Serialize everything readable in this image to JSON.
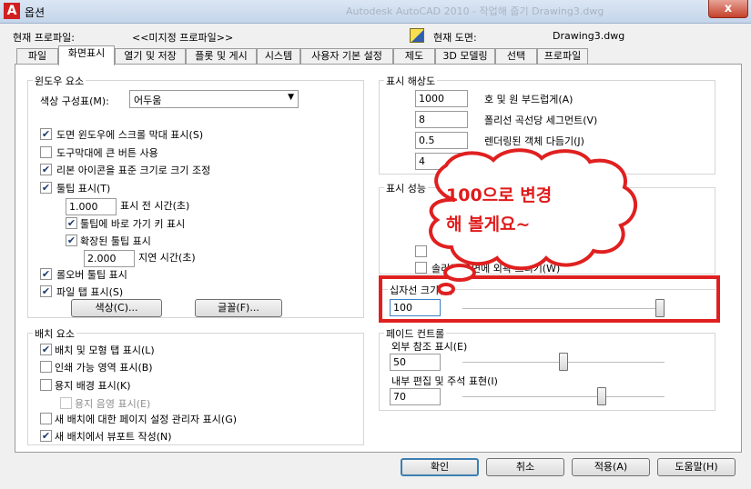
{
  "window": {
    "app_icon": "A",
    "title": "옵션",
    "background_title": "Autodesk AutoCAD 2010 - 작업해 줍기   Drawing3.dwg",
    "close_glyph": "x"
  },
  "profile": {
    "label": "현재 프로파일:",
    "value": "<<미지정 프로파일>>",
    "drawing_label": "현재 도면:",
    "drawing_value": "Drawing3.dwg"
  },
  "tabs": [
    "파일",
    "화면표시",
    "열기 및 저장",
    "플롯 및 게시",
    "시스템",
    "사용자 기본 설정",
    "제도",
    "3D 모델링",
    "선택",
    "프로파일"
  ],
  "active_tab": "화면표시",
  "window_elements": {
    "title": "윈도우 요소",
    "color_scheme_label": "색상 구성표(M):",
    "color_scheme_value": "어두움",
    "checks": [
      {
        "label": "도면 윈도우에 스크롤 막대 표시(S)",
        "checked": true
      },
      {
        "label": "도구막대에 큰 버튼 사용",
        "checked": false
      },
      {
        "label": "리본 아이콘을 표준 크기로 크기 조정",
        "checked": true
      },
      {
        "label": "툴팁 표시(T)",
        "checked": true
      }
    ],
    "tooltip_delay_value": "1.000",
    "tooltip_delay_label": "표시 전 시간(초)",
    "sub_checks": [
      {
        "label": "툴팁에 바로 가기 키 표시",
        "checked": true
      },
      {
        "label": "확장된 툴팁 표시",
        "checked": true
      }
    ],
    "extended_delay_value": "2.000",
    "extended_delay_label": "지연 시간(초)",
    "rollover_label": "롤오버 툴팁 표시",
    "file_tabs_label": "파일 탭 표시(S)",
    "colors_button": "색상(C)...",
    "fonts_button": "글꼴(F)..."
  },
  "layout_elements": {
    "title": "배치 요소",
    "checks": [
      {
        "label": "배치 및 모형 탭 표시(L)",
        "checked": true,
        "disabled": false
      },
      {
        "label": "인쇄 가능 영역 표시(B)",
        "checked": false,
        "disabled": false
      },
      {
        "label": "용지 배경 표시(K)",
        "checked": false,
        "disabled": false
      },
      {
        "label": "용지 음영 표시(E)",
        "checked": false,
        "disabled": true
      },
      {
        "label": "새 배치에 대한 페이지 설정 관리자 표시(G)",
        "checked": false,
        "disabled": false
      },
      {
        "label": "새 배치에서 뷰포트 작성(N)",
        "checked": true,
        "disabled": false
      }
    ]
  },
  "display_resolution": {
    "title": "표시 해상도",
    "rows": [
      {
        "value": "1000",
        "label": "호 및 원 부드럽게(A)"
      },
      {
        "value": "8",
        "label": "폴리선 곡선당 세그먼트(V)"
      },
      {
        "value": "0.5",
        "label": "렌더링된 객체 다듬기(J)"
      },
      {
        "value": "4",
        "label": ""
      }
    ]
  },
  "display_performance": {
    "title": "표시 성능",
    "last_row_label": "솔리드 표면에 외곽 그리기(W)"
  },
  "crosshair": {
    "label": "십자선 크기(Z)",
    "value": "100",
    "slider_level": 100
  },
  "fade_control": {
    "title": "페이드 컨트롤",
    "xref_label": "외부 참조 표시(E)",
    "xref_value": "50",
    "xref_level": 50,
    "inplace_label": "내부 편집 및 주석 표현(I)",
    "inplace_value": "70",
    "inplace_level": 70
  },
  "annotation": {
    "text": "100으로 변경\n해 볼게요~",
    "color": "#e01b1b"
  },
  "footer": {
    "ok": "확인",
    "cancel": "취소",
    "apply": "적용(A)",
    "help": "도움말(H)"
  }
}
